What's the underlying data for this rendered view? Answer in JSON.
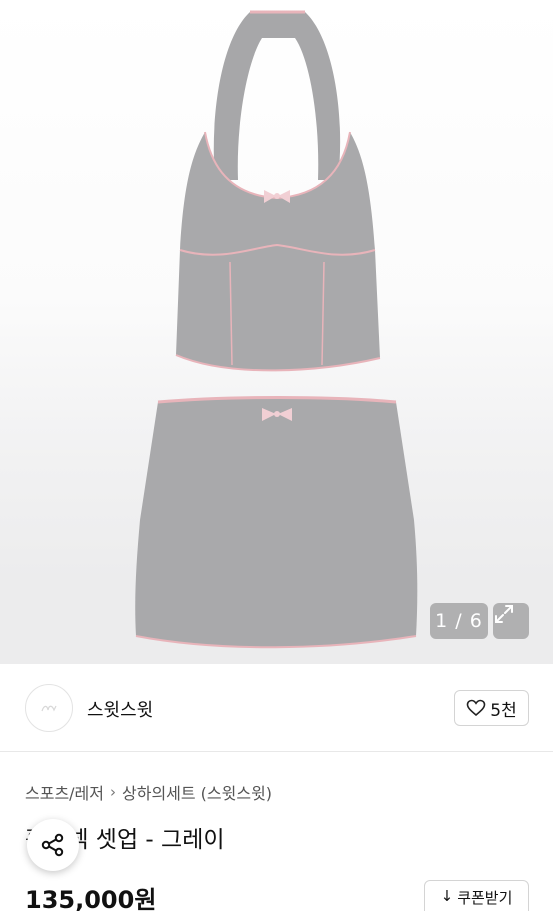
{
  "gallery": {
    "counter": "1 / 6",
    "image_alt": "grey halter top and mini skirt set"
  },
  "seller": {
    "name": "스윗스윗",
    "favorite_count": "5천"
  },
  "product": {
    "breadcrumb": [
      "스포츠/레저",
      "상하의세트 (스윗스윗)"
    ],
    "title": "홀터넥 셋업 - 그레이",
    "price": "135,000원",
    "coupon_label": "쿠폰받기"
  },
  "icons": {
    "expand": "expand-icon",
    "heart": "heart-icon",
    "share": "share-icon",
    "download": "download-arrow-icon",
    "chevron": "chevron-right-icon"
  },
  "colors": {
    "garment": "#a9a9ab",
    "trim": "#e8b4ba",
    "bow": "#f1cfd4"
  }
}
